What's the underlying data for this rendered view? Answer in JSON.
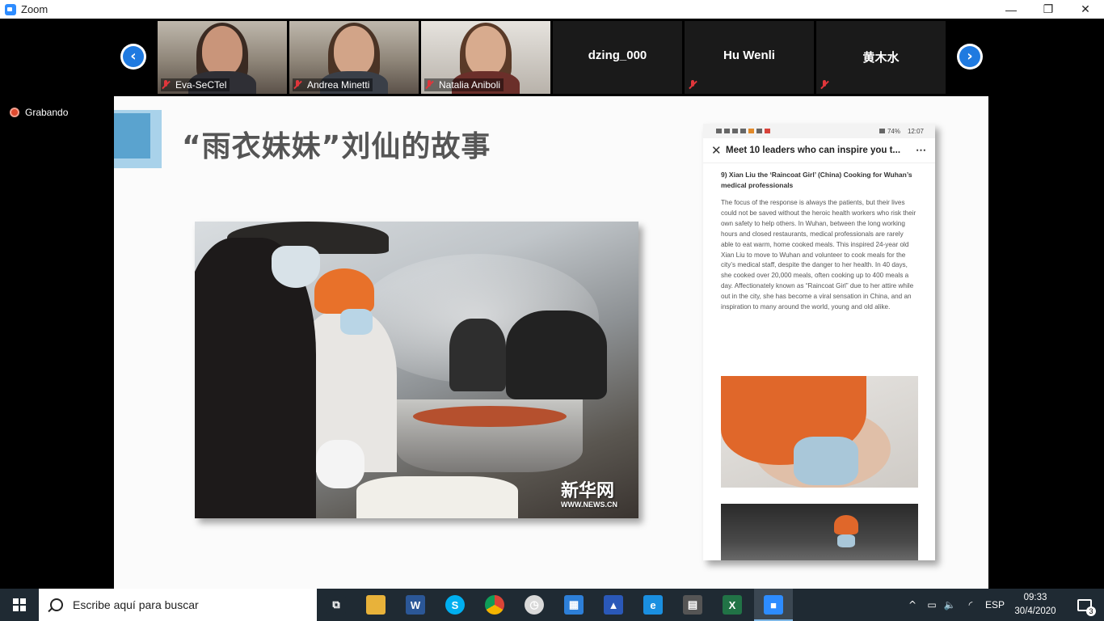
{
  "window": {
    "title": "Zoom",
    "controls": [
      "—",
      "❐",
      "✕"
    ]
  },
  "participants": [
    {
      "name": "Eva-SeCTel",
      "muted": true,
      "video": true
    },
    {
      "name": "Andrea Minetti",
      "muted": true,
      "video": true
    },
    {
      "name": "Natalia Aniboli",
      "muted": true,
      "video": true
    },
    {
      "name": "dzing_000",
      "muted": false,
      "video": false
    },
    {
      "name": "Hu Wenli",
      "muted": true,
      "video": false
    },
    {
      "name": "黄木水",
      "muted": true,
      "video": false
    }
  ],
  "nav": {
    "prev": "‹",
    "next": "›"
  },
  "recording": {
    "label": "Grabando"
  },
  "slide": {
    "title": "“雨衣妹妹”刘仙的故事",
    "photo": {
      "watermark_cn": "新华网",
      "watermark_url": "WWW.NEWS.CN"
    },
    "phone": {
      "status_time": "12:07",
      "status_battery": "74%",
      "header_title": "Meet 10 leaders who can inspire you t...",
      "close": "✕",
      "more": "⋯",
      "heading": "9) Xian Liu the ‘Raincoat Girl’ (China) Cooking for Wuhan’s medical professionals",
      "body": "The focus of the response is always the patients, but their lives could not be saved without the heroic health workers who risk their own safety to help others. In Wuhan, between the long working hours and closed restaurants, medical professionals are rarely able to eat warm, home cooked meals. This inspired 24-year old Xian Liu to move to Wuhan and volunteer to cook meals for the city’s medical staff, despite the danger to her health. In 40 days, she cooked over 20,000 meals, often cooking up to 400 meals a day. Affectionately known as “Raincoat Girl” due to her attire while out in the city, she has become a viral sensation in China, and an inspiration to many around the world, young and old alike."
    }
  },
  "taskbar": {
    "search_placeholder": "Escribe aquí para buscar",
    "apps": [
      {
        "icon": "task-view-icon",
        "glyph": "⧉",
        "color": "#1f2a33"
      },
      {
        "icon": "file-explorer-icon",
        "glyph": "",
        "color": "#e8b23a"
      },
      {
        "icon": "word-icon",
        "glyph": "W",
        "color": "#2b5797"
      },
      {
        "icon": "skype-icon",
        "glyph": "S",
        "color": "#00aff0"
      },
      {
        "icon": "chrome-icon",
        "glyph": "",
        "color": "#db4437"
      },
      {
        "icon": "clock-app-icon",
        "glyph": "◷",
        "color": "#d9d9d9"
      },
      {
        "icon": "calendar-icon",
        "glyph": "▦",
        "color": "#2d7fd8"
      },
      {
        "icon": "mail-icon",
        "glyph": "▲",
        "color": "#2a58b8"
      },
      {
        "icon": "edge-icon",
        "glyph": "e",
        "color": "#1a8fe0"
      },
      {
        "icon": "calculator-icon",
        "glyph": "▤",
        "color": "#555"
      },
      {
        "icon": "excel-icon",
        "glyph": "X",
        "color": "#217346"
      },
      {
        "icon": "zoom-app-icon",
        "glyph": "■",
        "color": "#2d8cff"
      }
    ],
    "language": "ESP",
    "time": "09:33",
    "date": "30/4/2020",
    "notifications": "3"
  }
}
